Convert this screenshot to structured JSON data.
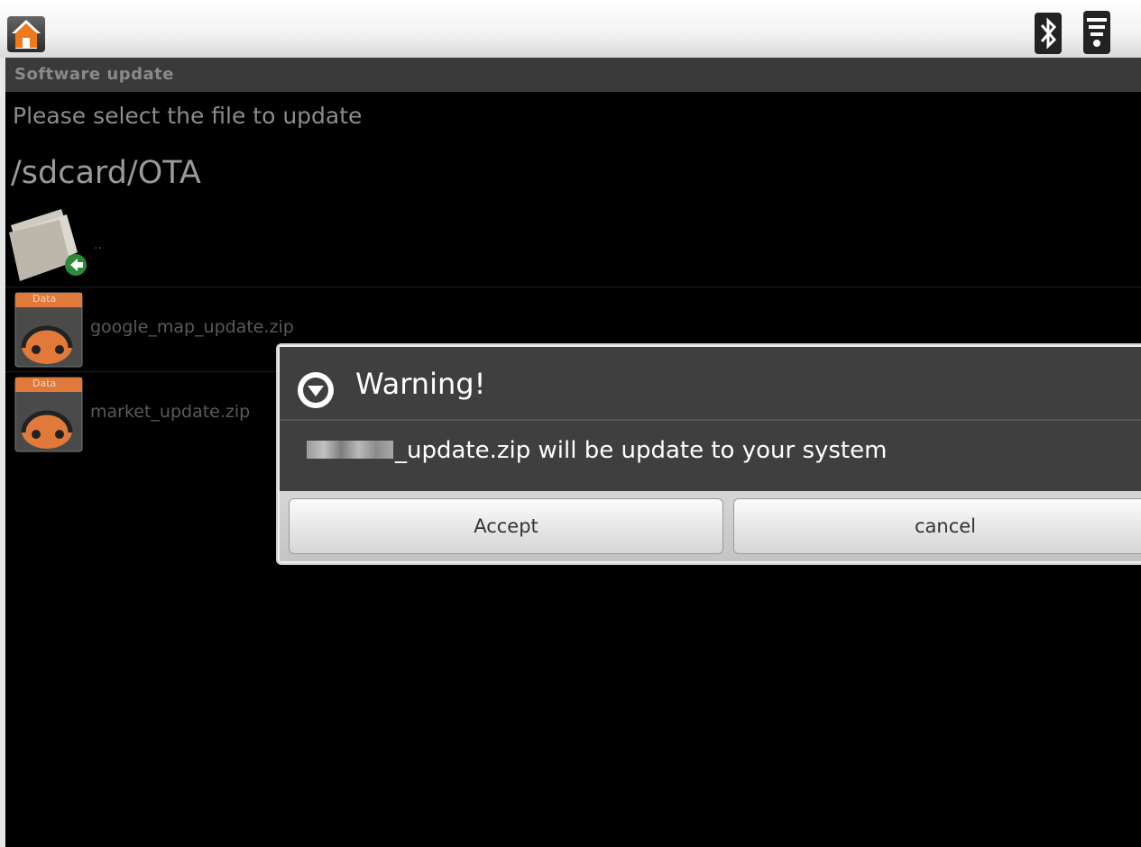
{
  "screen": {
    "title": "Software update",
    "prompt": "Please select the file to update",
    "path": "/sdcard/OTA"
  },
  "file_list": {
    "parent_label": "..",
    "items": [
      {
        "badge": "Data",
        "label": "google_map_update.zip"
      },
      {
        "badge": "Data",
        "label": "market_update.zip"
      }
    ]
  },
  "dialog": {
    "title": "Warning!",
    "message_suffix": "_update.zip will be update to your system",
    "accept_label": "Accept",
    "cancel_label": "cancel"
  },
  "colors": {
    "background": "#000000",
    "dialog_panel": "#3f3f3f",
    "file_badge": "#e0793a"
  },
  "icons": {
    "statusbar": [
      "home-icon",
      "bluetooth-icon",
      "wifi-icon"
    ],
    "parent": "folder-up-icon",
    "file": "data-package-icon",
    "dialog": "alert-chevron-down-icon"
  }
}
